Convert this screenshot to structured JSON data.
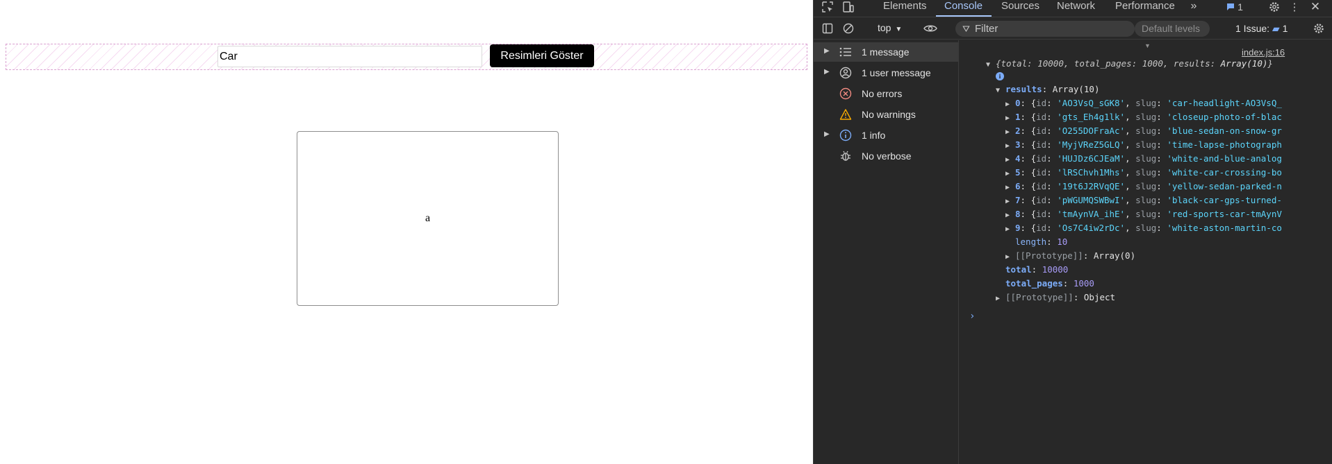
{
  "page": {
    "search_value": "Car",
    "show_button_label": "Resimleri Göster",
    "card_text": "a"
  },
  "devtools": {
    "tabs": [
      "Elements",
      "Console",
      "Sources",
      "Network",
      "Performance"
    ],
    "active_tab": "Console",
    "message_badge": "1",
    "toolbar": {
      "context": "top",
      "filter_placeholder": "Filter",
      "levels": "Default levels",
      "issues_label": "1 Issue:",
      "issues_count": "1"
    },
    "sidebar": [
      {
        "label": "1 message",
        "icon": "list-icon",
        "expandable": true,
        "selected": true
      },
      {
        "label": "1 user message",
        "icon": "user-icon",
        "expandable": true,
        "selected": false
      },
      {
        "label": "No errors",
        "icon": "error-icon",
        "expandable": false,
        "selected": false
      },
      {
        "label": "No warnings",
        "icon": "warning-icon",
        "expandable": false,
        "selected": false
      },
      {
        "label": "1 info",
        "icon": "info-icon",
        "expandable": true,
        "selected": false
      },
      {
        "label": "No verbose",
        "icon": "bug-icon",
        "expandable": false,
        "selected": false
      }
    ],
    "console": {
      "source": "index.js:16",
      "summary": {
        "total": "10000",
        "total_pages": "1000",
        "results": "Array(10)"
      },
      "results_label": "results",
      "results_type": "Array(10)",
      "items": [
        {
          "index": "0",
          "id": "'AO3VsQ_sGK8'",
          "slug": "'car-headlight-AO3VsQ_"
        },
        {
          "index": "1",
          "id": "'gts_Eh4g1lk'",
          "slug": "'closeup-photo-of-blac"
        },
        {
          "index": "2",
          "id": "'O255DOFraAc'",
          "slug": "'blue-sedan-on-snow-gr"
        },
        {
          "index": "3",
          "id": "'MyjVReZ5GLQ'",
          "slug": "'time-lapse-photograph"
        },
        {
          "index": "4",
          "id": "'HUJDz6CJEaM'",
          "slug": "'white-and-blue-analog"
        },
        {
          "index": "5",
          "id": "'lRSChvh1Mhs'",
          "slug": "'white-car-crossing-bo"
        },
        {
          "index": "6",
          "id": "'19t6J2RVqQE'",
          "slug": "'yellow-sedan-parked-n"
        },
        {
          "index": "7",
          "id": "'pWGUMQSWBwI'",
          "slug": "'black-car-gps-turned-"
        },
        {
          "index": "8",
          "id": "'tmAynVA_ihE'",
          "slug": "'red-sports-car-tmAynV"
        },
        {
          "index": "9",
          "id": "'Os7C4iw2rDc'",
          "slug": "'white-aston-martin-co"
        }
      ],
      "length": "10",
      "array_proto": "Array(0)",
      "total": "10000",
      "total_pages": "1000",
      "object_proto": "Object"
    }
  }
}
